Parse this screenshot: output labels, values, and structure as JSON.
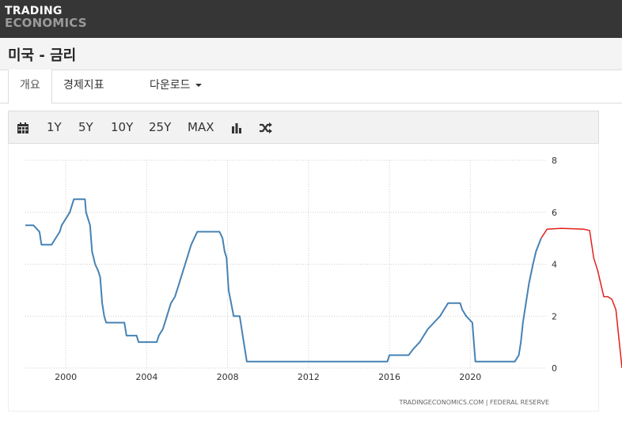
{
  "brand": {
    "line1": "TRADING",
    "line2": "ECONOMICS"
  },
  "page_title": "미국 - 금리",
  "tabs": [
    {
      "label": "개요"
    },
    {
      "label": "경제지표"
    },
    {
      "label": "다운로드"
    }
  ],
  "toolbar": {
    "ranges": [
      "1Y",
      "5Y",
      "10Y",
      "25Y",
      "MAX"
    ],
    "icons": [
      "calendar-icon",
      "bar-chart-icon",
      "shuffle-icon"
    ]
  },
  "chart_data": {
    "type": "line",
    "x_ticks": [
      "2000",
      "2004",
      "2008",
      "2012",
      "2016",
      "2020"
    ],
    "y_ticks": [
      "0",
      "2",
      "4",
      "6",
      "8"
    ],
    "xlim": [
      1998.0,
      2027.5
    ],
    "ylim": [
      0,
      8
    ],
    "grid": true,
    "source": "TRADINGECONOMICS.COM  |  FEDERAL RESERVE",
    "colors": {
      "actual": "#4682b4",
      "forecast": "#e0201b"
    },
    "series": [
      {
        "role": "actual",
        "x": [
          1998.0,
          1998.4,
          1998.7,
          1998.8,
          1999.3,
          1999.5,
          1999.7,
          1999.8,
          2000.0,
          2000.2,
          2000.4,
          2000.5,
          2000.95,
          2001.0,
          2001.2,
          2001.3,
          2001.45,
          2001.6,
          2001.7,
          2001.8,
          2001.9,
          2002.0,
          2002.9,
          2003.0,
          2003.5,
          2003.6,
          2004.5,
          2004.6,
          2004.8,
          2005.0,
          2005.2,
          2005.4,
          2005.6,
          2005.8,
          2006.0,
          2006.2,
          2006.5,
          2007.6,
          2007.75,
          2007.85,
          2007.95,
          2008.05,
          2008.3,
          2008.6,
          2008.8,
          2008.95,
          2015.9,
          2016.0,
          2016.95,
          2017.2,
          2017.5,
          2017.7,
          2017.9,
          2018.2,
          2018.5,
          2018.7,
          2018.9,
          2019.5,
          2019.6,
          2019.8,
          2020.1,
          2020.25,
          2022.2,
          2022.4,
          2022.5,
          2022.6,
          2022.75,
          2022.9,
          2023.1,
          2023.25,
          2023.5
        ],
        "y": [
          5.5,
          5.5,
          5.25,
          4.75,
          4.75,
          5.0,
          5.25,
          5.5,
          5.75,
          6.0,
          6.5,
          6.5,
          6.5,
          6.0,
          5.5,
          4.5,
          4.0,
          3.75,
          3.5,
          2.5,
          2.0,
          1.75,
          1.75,
          1.25,
          1.25,
          1.0,
          1.0,
          1.25,
          1.5,
          2.0,
          2.5,
          2.75,
          3.25,
          3.75,
          4.25,
          4.75,
          5.25,
          5.25,
          5.0,
          4.5,
          4.25,
          3.0,
          2.0,
          2.0,
          1.0,
          0.25,
          0.25,
          0.5,
          0.5,
          0.75,
          1.0,
          1.25,
          1.5,
          1.75,
          2.0,
          2.25,
          2.5,
          2.5,
          2.25,
          2.0,
          1.75,
          0.25,
          0.25,
          0.5,
          1.0,
          1.75,
          2.5,
          3.25,
          4.0,
          4.5,
          5.0
        ]
      },
      {
        "role": "forecast",
        "x": [
          2023.5,
          2023.8,
          2024.5,
          2025.6,
          2025.9,
          2026.1,
          2026.3,
          2026.6,
          2026.8,
          2027.0,
          2027.2,
          2027.5
        ],
        "y": [
          5.0,
          5.35,
          5.38,
          5.35,
          5.3,
          4.25,
          3.75,
          2.75,
          2.75,
          2.65,
          2.25,
          0.0
        ]
      }
    ]
  }
}
